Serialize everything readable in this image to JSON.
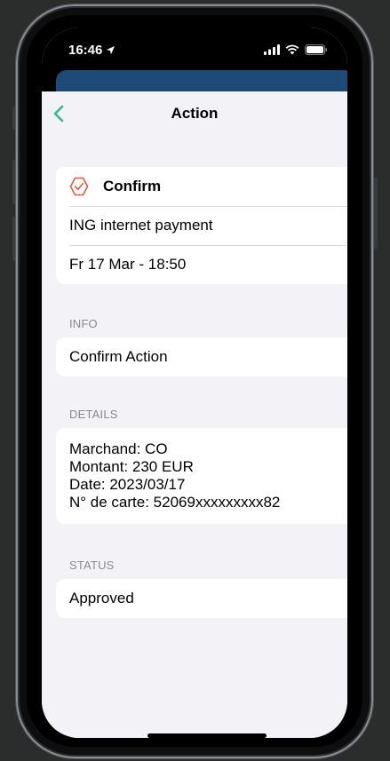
{
  "status_bar": {
    "time": "16:46"
  },
  "nav": {
    "title": "Action",
    "back_icon": "chevron-left-icon",
    "accent": "#2ebd8a"
  },
  "action_card": {
    "title": "Confirm",
    "icon": "confirm-check-icon",
    "icon_color": "#e8573b",
    "description": "ING internet payment",
    "datetime": "Fr 17 Mar - 18:50"
  },
  "info": {
    "label": "INFO",
    "value": "Confirm Action"
  },
  "details": {
    "label": "DETAILS",
    "lines": [
      "Marchand: CO",
      "Montant: 230 EUR",
      "Date: 2023/03/17",
      "N° de carte: 52069xxxxxxxxx82"
    ]
  },
  "status": {
    "label": "STATUS",
    "value": "Approved"
  }
}
